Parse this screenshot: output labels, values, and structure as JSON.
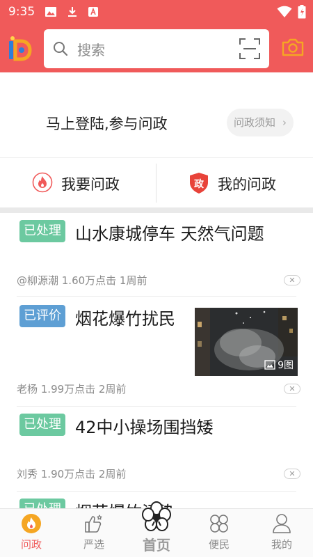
{
  "status_bar": {
    "time": "9:35"
  },
  "search": {
    "placeholder": "搜索"
  },
  "login": {
    "prompt": "马上登陆,参与问政",
    "notice_button": "问政须知"
  },
  "actions": [
    {
      "label": "我要问政",
      "icon": "flame-circle-icon"
    },
    {
      "label": "我的问政",
      "icon": "shield-zheng-icon",
      "icon_text": "政"
    }
  ],
  "feed": [
    {
      "status": "已处理",
      "title": "山水康城停车 天然气问题",
      "meta": "@柳源潮 1.60万点击 1周前"
    },
    {
      "status": "已评价",
      "title": "烟花爆竹扰民",
      "meta": "老杨 1.99万点击 2周前",
      "image_count": "9图"
    },
    {
      "status": "已处理",
      "title": "42中小操场围挡矮",
      "meta": "刘秀 1.90万点击 2周前"
    },
    {
      "status": "已处理",
      "title": "烟花爆竹污染"
    }
  ],
  "tabs": [
    {
      "label": "问政",
      "icon": "flame-icon",
      "active": true
    },
    {
      "label": "严选",
      "icon": "thumbs-up-icon"
    },
    {
      "label": "首页",
      "icon": "blossom-icon"
    },
    {
      "label": "便民",
      "icon": "grid-circles-icon"
    },
    {
      "label": "我的",
      "icon": "person-icon"
    }
  ],
  "colors": {
    "brand_red": "#f05a5a",
    "badge_green": "#6cc9a0",
    "badge_blue": "#5e9fd4",
    "camera_orange": "#f5a623"
  }
}
